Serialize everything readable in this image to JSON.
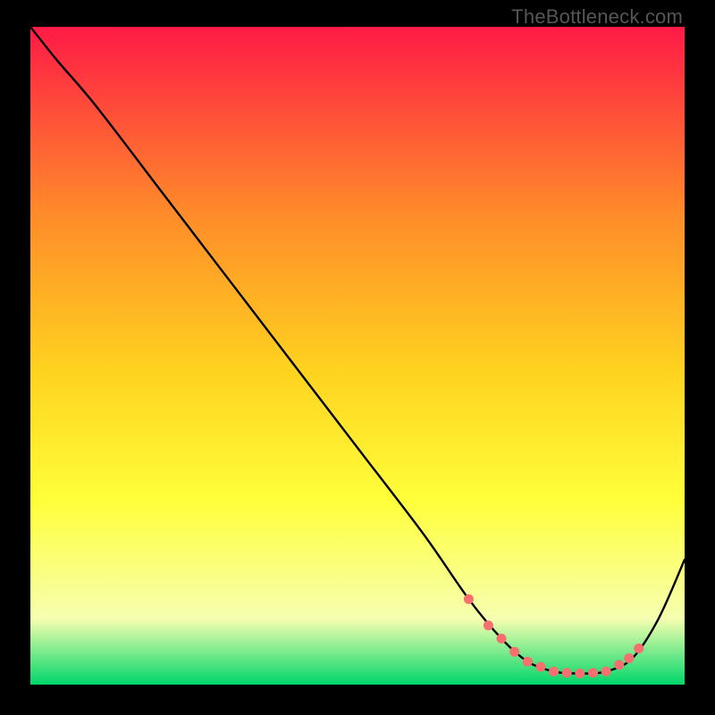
{
  "watermark": "TheBottleneck.com",
  "colors": {
    "gradient_top": "#ff1a46",
    "gradient_mid_upper": "#ff8a2a",
    "gradient_mid": "#ffd21f",
    "gradient_mid_lower": "#ffff3a",
    "gradient_low": "#f6ffb0",
    "gradient_bottom": "#00d66a",
    "curve": "#000000",
    "marker": "#f76f6f",
    "frame": "#000000"
  },
  "chart_data": {
    "type": "line",
    "title": "",
    "xlabel": "",
    "ylabel": "",
    "xlim": [
      0,
      100
    ],
    "ylim": [
      0,
      100
    ],
    "series": [
      {
        "name": "bottleneck-curve",
        "x": [
          0,
          4,
          10,
          20,
          30,
          40,
          50,
          60,
          67,
          72,
          76,
          80,
          84,
          88,
          92,
          96,
          100
        ],
        "y": [
          100,
          95,
          88,
          75,
          62,
          49,
          36,
          23,
          13,
          7,
          3.5,
          2,
          1.7,
          2,
          4,
          10,
          19
        ]
      }
    ],
    "markers": {
      "name": "highlighted-points",
      "x": [
        67,
        70,
        72,
        74,
        76,
        78,
        80,
        82,
        84,
        86,
        88,
        90,
        91.5,
        93
      ],
      "y": [
        13,
        9,
        7,
        5,
        3.5,
        2.7,
        2,
        1.8,
        1.7,
        1.8,
        2,
        3,
        4,
        5.5
      ]
    }
  }
}
